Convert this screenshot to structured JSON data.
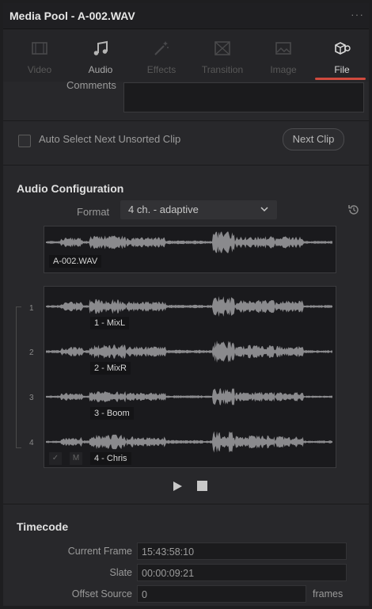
{
  "window": {
    "title": "Media Pool - A-002.WAV",
    "menu_glyph": "···"
  },
  "tabs": [
    {
      "label": "Video",
      "icon": "video-icon",
      "active": false
    },
    {
      "label": "Audio",
      "icon": "music-note-icon",
      "active": false
    },
    {
      "label": "Effects",
      "icon": "magic-wand-icon",
      "active": false
    },
    {
      "label": "Transition",
      "icon": "transition-icon",
      "active": false
    },
    {
      "label": "Image",
      "icon": "image-icon",
      "active": false
    },
    {
      "label": "File",
      "icon": "file-cubes-icon",
      "active": true
    }
  ],
  "comments": {
    "label": "Comments",
    "value": ""
  },
  "auto_select": {
    "label": "Auto Select Next Unsorted Clip",
    "checked": false
  },
  "next_clip": {
    "label": "Next Clip"
  },
  "audio_config": {
    "title": "Audio Configuration",
    "format_label": "Format",
    "format_value": "4 ch. - adaptive",
    "source_clip": "A-002.WAV",
    "channels": [
      {
        "num": "1",
        "name": "1 - MixL"
      },
      {
        "num": "2",
        "name": "2 - MixR"
      },
      {
        "num": "3",
        "name": "3 - Boom"
      },
      {
        "num": "4",
        "name": "4 - Chris"
      }
    ],
    "check_glyph": "✓",
    "mute_glyph": "M"
  },
  "timecode": {
    "title": "Timecode",
    "current_frame_label": "Current Frame",
    "current_frame_value": "15:43:58:10",
    "slate_label": "Slate",
    "slate_value": "00:00:09:21",
    "offset_label": "Offset Source",
    "offset_value": "0",
    "frames_label": "frames"
  },
  "colors": {
    "accent": "#d04a3e",
    "panel": "#28282b",
    "waveform": "#8a8a8d"
  }
}
